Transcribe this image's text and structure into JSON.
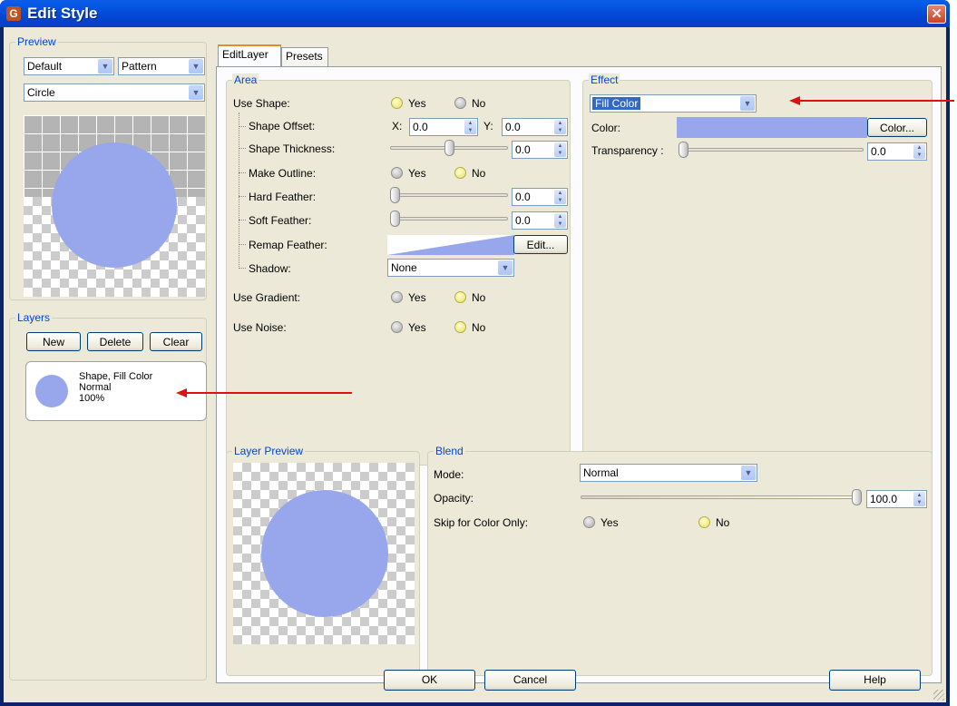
{
  "window": {
    "title": "Edit Style",
    "icon": "G"
  },
  "colors": {
    "fill": "#98a6ec",
    "accent_blue": "#0046d5",
    "annotation_red": "#e01010"
  },
  "preview": {
    "group_label": "Preview",
    "combo_default": "Default",
    "combo_pattern": "Pattern",
    "combo_shape": "Circle"
  },
  "layers": {
    "group_label": "Layers",
    "new_label": "New",
    "delete_label": "Delete",
    "clear_label": "Clear",
    "items": [
      {
        "line1": "Shape, Fill Color",
        "line2": "Normal",
        "line3": "100%"
      }
    ]
  },
  "tabs": [
    {
      "label": "EditLayer"
    },
    {
      "label": "Presets"
    }
  ],
  "area": {
    "group_label": "Area",
    "use_shape": {
      "label": "Use Shape:",
      "yes": "Yes",
      "no": "No",
      "selected": "Yes"
    },
    "shape_offset": {
      "label": "Shape Offset:",
      "x_label": "X:",
      "x_value": "0.0",
      "y_label": "Y:",
      "y_value": "0.0"
    },
    "shape_thickness": {
      "label": "Shape Thickness:",
      "value": "0.0",
      "level": 0.5
    },
    "make_outline": {
      "label": "Make Outline:",
      "yes": "Yes",
      "no": "No",
      "selected": "No"
    },
    "hard_feather": {
      "label": "Hard Feather:",
      "value": "0.0",
      "level": 0
    },
    "soft_feather": {
      "label": "Soft Feather:",
      "value": "0.0",
      "level": 0
    },
    "remap_feather": {
      "label": "Remap Feather:",
      "edit_label": "Edit..."
    },
    "shadow": {
      "label": "Shadow:",
      "value": "None"
    },
    "use_gradient": {
      "label": "Use Gradient:",
      "yes": "Yes",
      "no": "No",
      "selected": "No"
    },
    "use_noise": {
      "label": "Use Noise:",
      "yes": "Yes",
      "no": "No",
      "selected": "No"
    }
  },
  "effect": {
    "group_label": "Effect",
    "type": "Fill Color",
    "color_label": "Color:",
    "color_button": "Color...",
    "transparency_label": "Transparency :",
    "transparency_value": "0.0",
    "transparency_level": 0
  },
  "layer_preview": {
    "group_label": "Layer Preview"
  },
  "blend": {
    "group_label": "Blend",
    "mode_label": "Mode:",
    "mode_value": "Normal",
    "opacity_label": "Opacity:",
    "opacity_value": "100.0",
    "opacity_level": 1.0,
    "skip_label": "Skip for Color Only:",
    "yes": "Yes",
    "no": "No",
    "selected": "No"
  },
  "footer": {
    "ok_label": "OK",
    "cancel_label": "Cancel",
    "help_label": "Help"
  }
}
